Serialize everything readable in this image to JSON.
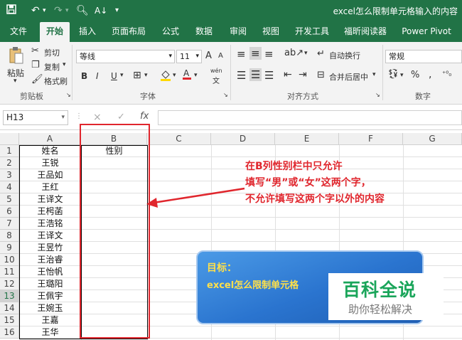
{
  "window": {
    "title": "excel怎么限制单元格输入的内容"
  },
  "tabs": [
    "文件",
    "开始",
    "插入",
    "页面布局",
    "公式",
    "数据",
    "审阅",
    "视图",
    "开发工具",
    "福昕阅读器",
    "Power Pivot"
  ],
  "active_tab": "开始",
  "ribbon": {
    "clipboard": {
      "paste": "粘贴",
      "cut": "剪切",
      "copy": "复制",
      "format_painter": "格式刷",
      "group": "剪贴板"
    },
    "font": {
      "name": "等线",
      "size": "11",
      "bold": "B",
      "italic": "I",
      "underline": "U",
      "grow": "A",
      "shrink": "A",
      "wen": "wén",
      "group": "字体"
    },
    "alignment": {
      "wrap": "自动换行",
      "merge": "合并后居中",
      "group": "对齐方式"
    },
    "number": {
      "format": "常规",
      "percent": "%",
      "group": "数字"
    }
  },
  "formula_bar": {
    "name_box": "H13",
    "fx": "fx",
    "cancel": "×",
    "enter": "✓"
  },
  "columns": [
    "A",
    "B",
    "C",
    "D",
    "E",
    "F",
    "G"
  ],
  "rows": [
    "1",
    "2",
    "3",
    "4",
    "5",
    "6",
    "7",
    "8",
    "9",
    "10",
    "11",
    "12",
    "13",
    "14",
    "15",
    "16"
  ],
  "selected_row": "13",
  "cells": {
    "b1": "性别",
    "column_a": [
      "姓名",
      "王锐",
      "王品如",
      "王红",
      "王译文",
      "王枵菡",
      "王浩铭",
      "王译文",
      "王昱竹",
      "王治睿",
      "王怡帆",
      "王璐阳",
      "王佩宇",
      "王婉玉",
      "王嘉",
      "王华"
    ]
  },
  "annotation": {
    "line1": "在B列性别栏中只允许",
    "line2": "填写“男”或“女”这两个字，",
    "line3": "不允许填写这两个字以外的内容",
    "color": "#e0262d"
  },
  "goal_box": {
    "label": "目标：",
    "text": "excel怎么限制单元格"
  },
  "watermark": {
    "name": "百科全说",
    "slogan": "助你轻松解决"
  },
  "colors": {
    "excel_green": "#217346",
    "accent_red": "#e0262d",
    "goal_blue": "#2a74cf",
    "goal_text": "#ffe04a",
    "logo_green": "#1aa55a"
  }
}
